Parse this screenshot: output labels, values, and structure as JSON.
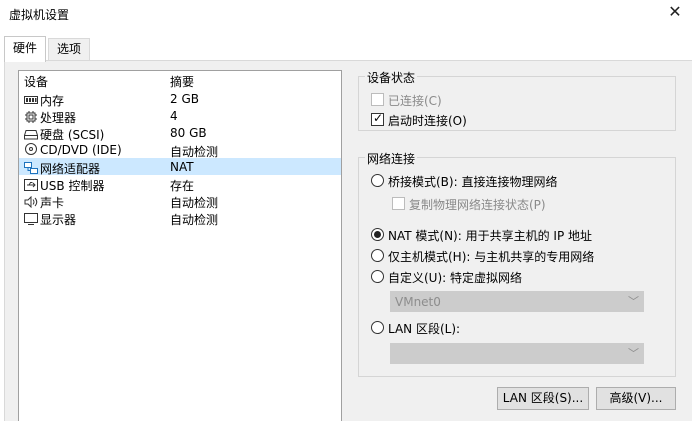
{
  "window": {
    "title": "虚拟机设置"
  },
  "tabs": [
    {
      "label": "硬件"
    },
    {
      "label": "选项"
    }
  ],
  "devices": {
    "header": {
      "device": "设备",
      "summary": "摘要"
    },
    "rows": [
      {
        "icon": "memory-icon",
        "name": "内存",
        "summary": "2 GB"
      },
      {
        "icon": "processor-icon",
        "name": "处理器",
        "summary": "4"
      },
      {
        "icon": "harddisk-icon",
        "name": "硬盘 (SCSI)",
        "summary": "80 GB"
      },
      {
        "icon": "cd-icon",
        "name": "CD/DVD (IDE)",
        "summary": "自动检测"
      },
      {
        "icon": "network-icon",
        "name": "网络适配器",
        "summary": "NAT"
      },
      {
        "icon": "usb-icon",
        "name": "USB 控制器",
        "summary": "存在"
      },
      {
        "icon": "sound-icon",
        "name": "声卡",
        "summary": "自动检测"
      },
      {
        "icon": "monitor-icon",
        "name": "显示器",
        "summary": "自动检测"
      }
    ]
  },
  "device_status": {
    "title": "设备状态",
    "connected": {
      "label": "已连接(C)",
      "checked": false,
      "enabled": false
    },
    "connect_at_power_on": {
      "label": "启动时连接(O)",
      "checked": true
    }
  },
  "network": {
    "title": "网络连接",
    "bridged": {
      "label": "桥接模式(B): 直接连接物理网络",
      "selected": false
    },
    "replicate": {
      "label": "复制物理网络连接状态(P)",
      "checked": false,
      "enabled": false
    },
    "nat": {
      "label": "NAT 模式(N): 用于共享主机的 IP 地址",
      "selected": true
    },
    "host_only": {
      "label": "仅主机模式(H): 与主机共享的专用网络",
      "selected": false
    },
    "custom": {
      "label": "自定义(U): 特定虚拟网络",
      "selected": false
    },
    "custom_select": {
      "value": "VMnet0"
    },
    "lan_segment": {
      "label": "LAN 区段(L):",
      "selected": false
    },
    "lan_select": {
      "value": ""
    }
  },
  "buttons": {
    "lan_segments": "LAN 区段(S)...",
    "advanced": "高级(V)..."
  },
  "colors": {
    "selection": "#cce8ff",
    "panel": "#f0f0f0",
    "network_icon": "#1e73be"
  }
}
